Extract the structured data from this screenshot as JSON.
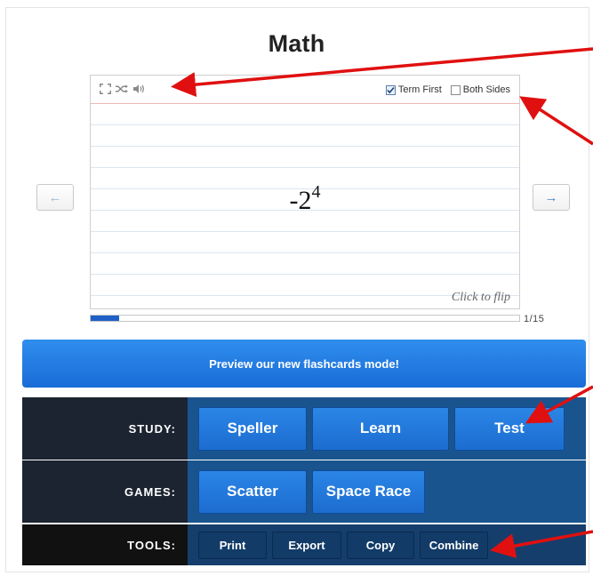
{
  "title": "Math",
  "card": {
    "term_base": "-2",
    "term_exponent": "4",
    "flip_hint": "Click to flip",
    "options": [
      {
        "label": "Term First",
        "checked": true
      },
      {
        "label": "Both Sides",
        "checked": false
      }
    ],
    "toolbar_icons": [
      "fullscreen-icon",
      "shuffle-icon",
      "speaker-icon"
    ]
  },
  "nav": {
    "prev_glyph": "←",
    "next_glyph": "→"
  },
  "progress": {
    "counter": "1/15",
    "fraction": 0.0667
  },
  "preview_banner": "Preview our new flashcards mode!",
  "panel": {
    "study": {
      "label": "STUDY:",
      "buttons": [
        "Speller",
        "Learn",
        "Test"
      ]
    },
    "games": {
      "label": "GAMES:",
      "buttons": [
        "Scatter",
        "Space Race"
      ]
    },
    "tools": {
      "label": "TOOLS:",
      "buttons": [
        "Print",
        "Export",
        "Copy",
        "Combine"
      ]
    }
  },
  "colors": {
    "accent": "#1a6cd6",
    "annotation": "#e01010"
  }
}
